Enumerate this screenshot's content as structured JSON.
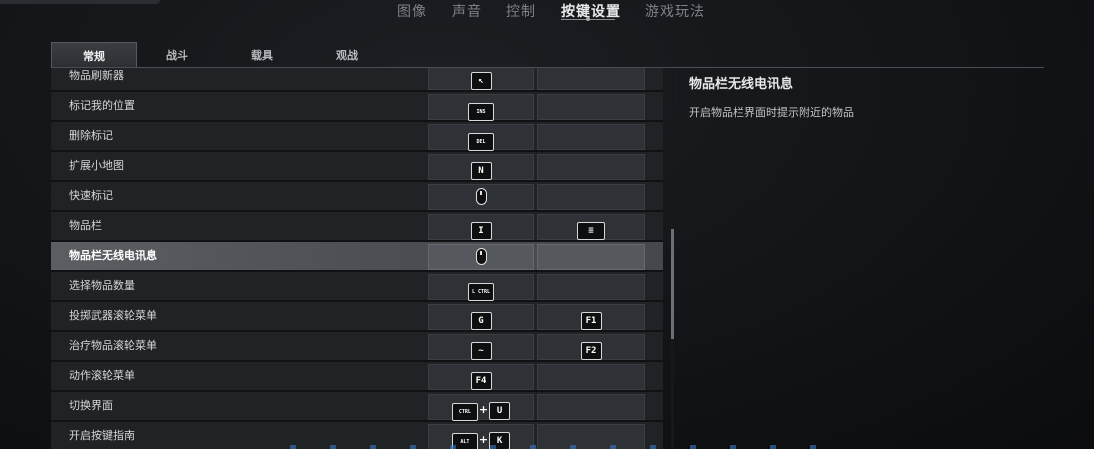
{
  "top_nav": {
    "items": [
      "图像",
      "声音",
      "控制",
      "按键设置",
      "游戏玩法"
    ],
    "active": "按键设置"
  },
  "sub_tabs": {
    "items": [
      "常规",
      "战斗",
      "载具",
      "观战"
    ],
    "active": "常规"
  },
  "rows": [
    {
      "label": "物品刷新器",
      "primary": {
        "type": "icon",
        "icon": "cursor-arrow-icon"
      },
      "secondary": null
    },
    {
      "label": "标记我的位置",
      "primary": {
        "type": "key",
        "text": "INS"
      },
      "secondary": null
    },
    {
      "label": "删除标记",
      "primary": {
        "type": "key",
        "text": "DEL"
      },
      "secondary": null
    },
    {
      "label": "扩展小地图",
      "primary": {
        "type": "key",
        "text": "N"
      },
      "secondary": null
    },
    {
      "label": "快速标记",
      "primary": {
        "type": "icon",
        "icon": "mouse-middle-icon"
      },
      "secondary": null
    },
    {
      "label": "物品栏",
      "primary": {
        "type": "key",
        "text": "I"
      },
      "secondary": {
        "type": "icon",
        "icon": "gamepad-view-icon"
      }
    },
    {
      "label": "物品栏无线电讯息",
      "primary": {
        "type": "icon",
        "icon": "mouse-middle-icon"
      },
      "secondary": null,
      "highlight": true
    },
    {
      "label": "选择物品数量",
      "primary": {
        "type": "key",
        "text": "L CTRL"
      },
      "secondary": null
    },
    {
      "label": "投掷武器滚轮菜单",
      "primary": {
        "type": "key",
        "text": "G"
      },
      "secondary": {
        "type": "key",
        "text": "F1"
      }
    },
    {
      "label": "治疗物品滚轮菜单",
      "primary": {
        "type": "key",
        "text": "~"
      },
      "secondary": {
        "type": "key",
        "text": "F2"
      }
    },
    {
      "label": "动作滚轮菜单",
      "primary": {
        "type": "key",
        "text": "F4"
      },
      "secondary": null
    },
    {
      "label": "切换界面",
      "primary": {
        "type": "combo",
        "keys": [
          "CTRL",
          "U"
        ]
      },
      "secondary": null
    },
    {
      "label": "开启按键指南",
      "primary": {
        "type": "combo",
        "keys": [
          "ALT",
          "K"
        ]
      },
      "secondary": null
    }
  ],
  "detail": {
    "title": "物品栏无线电讯息",
    "description": "开启物品栏界面时提示附近的物品"
  },
  "combo_separator": "+"
}
